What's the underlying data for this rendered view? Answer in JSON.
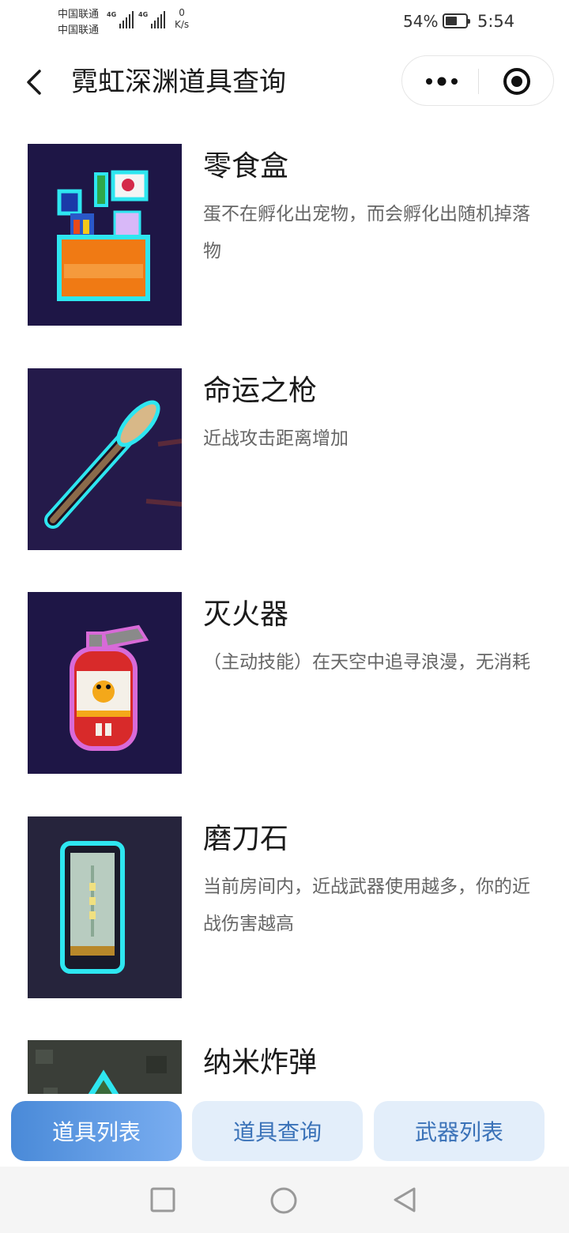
{
  "status_bar": {
    "carrier_1": "中国联通",
    "carrier_2": "中国联通",
    "network_type_1": "4G",
    "network_type_2": "4G",
    "net_speed_value": "0",
    "net_speed_unit": "K/s",
    "battery_percent": "54%",
    "time": "5:54"
  },
  "nav": {
    "title": "霓虹深渊道具查询",
    "back_icon": "chevron-left-icon",
    "more_icon": "more-dots-icon",
    "close_icon": "target-close-icon"
  },
  "items": [
    {
      "name": "零食盒",
      "desc": "蛋不在孵化出宠物，而会孵化出随机掉落物"
    },
    {
      "name": "命运之枪",
      "desc": "近战攻击距离增加"
    },
    {
      "name": "灭火器",
      "desc": "（主动技能）在天空中追寻浪漫，无消耗"
    },
    {
      "name": "磨刀石",
      "desc": "当前房间内，近战武器使用越多，你的近战伤害越高"
    },
    {
      "name": "纳米炸弹",
      "desc": ""
    }
  ],
  "tabs": [
    {
      "label": "道具列表",
      "active": true
    },
    {
      "label": "道具查询",
      "active": false
    },
    {
      "label": "武器列表",
      "active": false
    }
  ],
  "colors": {
    "accent_start": "#4a8ad8",
    "accent_end": "#79adf0",
    "tab_inactive_bg": "#e3eefa",
    "tab_inactive_text": "#3a72b8",
    "thumb_bg": "#1e1646"
  },
  "system_nav": {
    "recents_icon": "square-recents-icon",
    "home_icon": "circle-home-icon",
    "back_icon": "triangle-back-icon"
  }
}
